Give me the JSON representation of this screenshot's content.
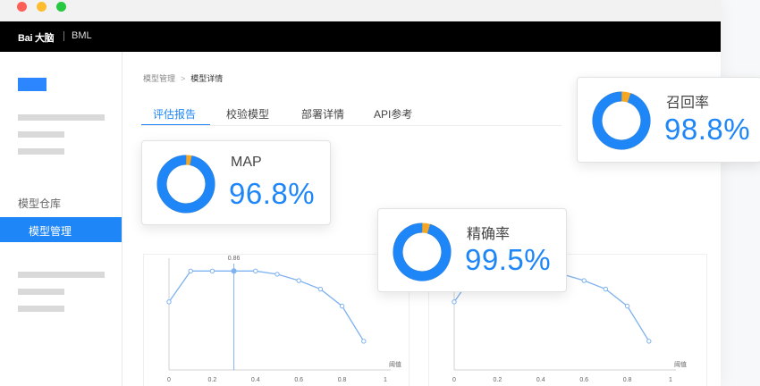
{
  "app": {
    "logo": "Bai 大脑",
    "product": "BML"
  },
  "breadcrumb": {
    "parent": "模型管理",
    "separator": ">",
    "current": "模型详情"
  },
  "tabs": [
    {
      "label": "评估报告",
      "active": true
    },
    {
      "label": "校验模型",
      "active": false
    },
    {
      "label": "部署详情",
      "active": false
    },
    {
      "label": "API参考",
      "active": false
    }
  ],
  "sidebar": {
    "section_label": "模型仓库",
    "active_item": "模型管理"
  },
  "metrics": {
    "map": {
      "label": "MAP",
      "value": "96.8%",
      "fraction": 0.968
    },
    "precision": {
      "label": "精确率",
      "value": "99.5%",
      "fraction": 0.955
    },
    "recall": {
      "label": "召回率",
      "value": "98.8%",
      "fraction": 0.948
    }
  },
  "colors": {
    "accent": "#1e86f7",
    "ring_remainder": "#f5a623"
  },
  "chart_data": [
    {
      "type": "line",
      "title": "",
      "ylabel": "F1-score",
      "xlabel": "阈值",
      "x_ticks": [
        "0",
        "0.2",
        "0.4",
        "0.6",
        "0.8",
        "1"
      ],
      "xlim": [
        0,
        1
      ],
      "ylim": [
        0,
        1
      ],
      "annotation": {
        "x": 0.3,
        "label": "0.86"
      },
      "x": [
        0,
        0.1,
        0.2,
        0.3,
        0.4,
        0.5,
        0.6,
        0.7,
        0.8,
        0.9
      ],
      "y": [
        0.64,
        0.93,
        0.93,
        0.93,
        0.93,
        0.9,
        0.84,
        0.76,
        0.6,
        0.27
      ]
    },
    {
      "type": "line",
      "title": "",
      "ylabel": "",
      "xlabel": "阈值",
      "x_ticks": [
        "0",
        "0.2",
        "0.4",
        "0.6",
        "0.8",
        "1"
      ],
      "xlim": [
        0,
        1
      ],
      "ylim": [
        0,
        1
      ],
      "x": [
        0,
        0.1,
        0.2,
        0.3,
        0.4,
        0.5,
        0.6,
        0.7,
        0.8,
        0.9
      ],
      "y": [
        0.64,
        0.93,
        0.93,
        0.93,
        0.93,
        0.9,
        0.84,
        0.76,
        0.6,
        0.27
      ]
    }
  ]
}
